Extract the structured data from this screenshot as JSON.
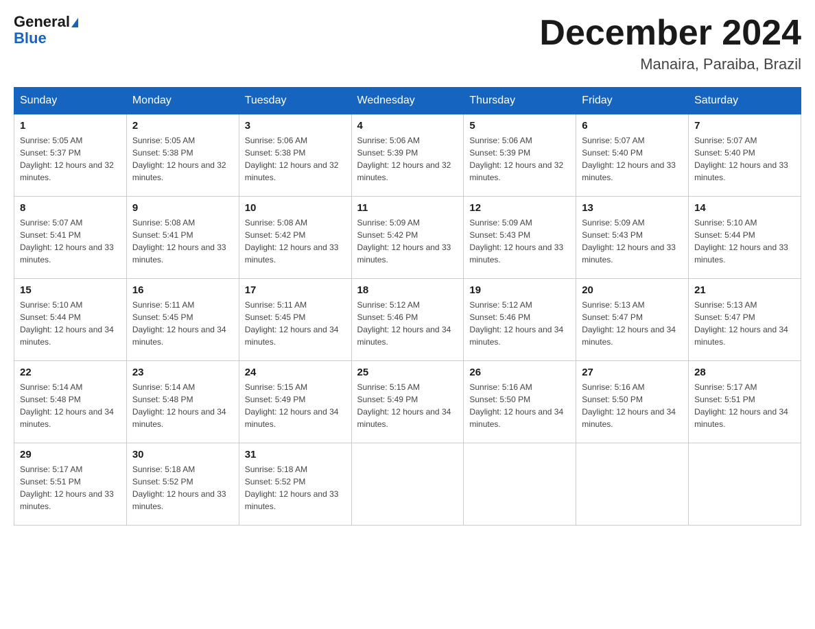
{
  "logo": {
    "general": "General",
    "blue": "Blue"
  },
  "title": "December 2024",
  "location": "Manaira, Paraiba, Brazil",
  "days_of_week": [
    "Sunday",
    "Monday",
    "Tuesday",
    "Wednesday",
    "Thursday",
    "Friday",
    "Saturday"
  ],
  "weeks": [
    [
      {
        "day": "1",
        "sunrise": "5:05 AM",
        "sunset": "5:37 PM",
        "daylight": "12 hours and 32 minutes."
      },
      {
        "day": "2",
        "sunrise": "5:05 AM",
        "sunset": "5:38 PM",
        "daylight": "12 hours and 32 minutes."
      },
      {
        "day": "3",
        "sunrise": "5:06 AM",
        "sunset": "5:38 PM",
        "daylight": "12 hours and 32 minutes."
      },
      {
        "day": "4",
        "sunrise": "5:06 AM",
        "sunset": "5:39 PM",
        "daylight": "12 hours and 32 minutes."
      },
      {
        "day": "5",
        "sunrise": "5:06 AM",
        "sunset": "5:39 PM",
        "daylight": "12 hours and 32 minutes."
      },
      {
        "day": "6",
        "sunrise": "5:07 AM",
        "sunset": "5:40 PM",
        "daylight": "12 hours and 33 minutes."
      },
      {
        "day": "7",
        "sunrise": "5:07 AM",
        "sunset": "5:40 PM",
        "daylight": "12 hours and 33 minutes."
      }
    ],
    [
      {
        "day": "8",
        "sunrise": "5:07 AM",
        "sunset": "5:41 PM",
        "daylight": "12 hours and 33 minutes."
      },
      {
        "day": "9",
        "sunrise": "5:08 AM",
        "sunset": "5:41 PM",
        "daylight": "12 hours and 33 minutes."
      },
      {
        "day": "10",
        "sunrise": "5:08 AM",
        "sunset": "5:42 PM",
        "daylight": "12 hours and 33 minutes."
      },
      {
        "day": "11",
        "sunrise": "5:09 AM",
        "sunset": "5:42 PM",
        "daylight": "12 hours and 33 minutes."
      },
      {
        "day": "12",
        "sunrise": "5:09 AM",
        "sunset": "5:43 PM",
        "daylight": "12 hours and 33 minutes."
      },
      {
        "day": "13",
        "sunrise": "5:09 AM",
        "sunset": "5:43 PM",
        "daylight": "12 hours and 33 minutes."
      },
      {
        "day": "14",
        "sunrise": "5:10 AM",
        "sunset": "5:44 PM",
        "daylight": "12 hours and 33 minutes."
      }
    ],
    [
      {
        "day": "15",
        "sunrise": "5:10 AM",
        "sunset": "5:44 PM",
        "daylight": "12 hours and 34 minutes."
      },
      {
        "day": "16",
        "sunrise": "5:11 AM",
        "sunset": "5:45 PM",
        "daylight": "12 hours and 34 minutes."
      },
      {
        "day": "17",
        "sunrise": "5:11 AM",
        "sunset": "5:45 PM",
        "daylight": "12 hours and 34 minutes."
      },
      {
        "day": "18",
        "sunrise": "5:12 AM",
        "sunset": "5:46 PM",
        "daylight": "12 hours and 34 minutes."
      },
      {
        "day": "19",
        "sunrise": "5:12 AM",
        "sunset": "5:46 PM",
        "daylight": "12 hours and 34 minutes."
      },
      {
        "day": "20",
        "sunrise": "5:13 AM",
        "sunset": "5:47 PM",
        "daylight": "12 hours and 34 minutes."
      },
      {
        "day": "21",
        "sunrise": "5:13 AM",
        "sunset": "5:47 PM",
        "daylight": "12 hours and 34 minutes."
      }
    ],
    [
      {
        "day": "22",
        "sunrise": "5:14 AM",
        "sunset": "5:48 PM",
        "daylight": "12 hours and 34 minutes."
      },
      {
        "day": "23",
        "sunrise": "5:14 AM",
        "sunset": "5:48 PM",
        "daylight": "12 hours and 34 minutes."
      },
      {
        "day": "24",
        "sunrise": "5:15 AM",
        "sunset": "5:49 PM",
        "daylight": "12 hours and 34 minutes."
      },
      {
        "day": "25",
        "sunrise": "5:15 AM",
        "sunset": "5:49 PM",
        "daylight": "12 hours and 34 minutes."
      },
      {
        "day": "26",
        "sunrise": "5:16 AM",
        "sunset": "5:50 PM",
        "daylight": "12 hours and 34 minutes."
      },
      {
        "day": "27",
        "sunrise": "5:16 AM",
        "sunset": "5:50 PM",
        "daylight": "12 hours and 34 minutes."
      },
      {
        "day": "28",
        "sunrise": "5:17 AM",
        "sunset": "5:51 PM",
        "daylight": "12 hours and 34 minutes."
      }
    ],
    [
      {
        "day": "29",
        "sunrise": "5:17 AM",
        "sunset": "5:51 PM",
        "daylight": "12 hours and 33 minutes."
      },
      {
        "day": "30",
        "sunrise": "5:18 AM",
        "sunset": "5:52 PM",
        "daylight": "12 hours and 33 minutes."
      },
      {
        "day": "31",
        "sunrise": "5:18 AM",
        "sunset": "5:52 PM",
        "daylight": "12 hours and 33 minutes."
      },
      null,
      null,
      null,
      null
    ]
  ],
  "labels": {
    "sunrise_prefix": "Sunrise: ",
    "sunset_prefix": "Sunset: ",
    "daylight_prefix": "Daylight: "
  }
}
